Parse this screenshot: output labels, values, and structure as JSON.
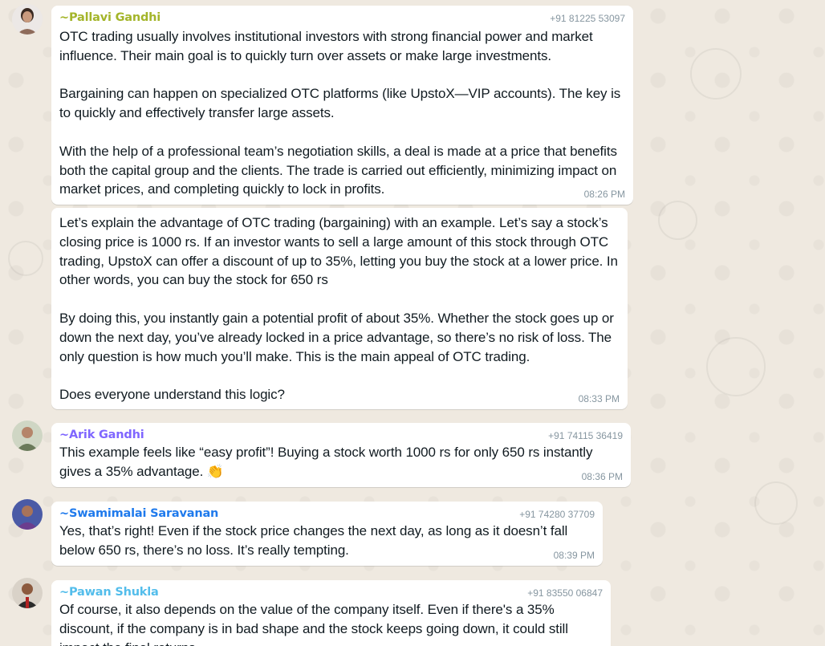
{
  "colors": {
    "background": "#efeae2",
    "bubble": "#ffffff",
    "text": "#111b21",
    "meta": "#8696a0"
  },
  "messages": [
    {
      "sender": "~Pallavi Gandhi",
      "sender_color": "#a4b52a",
      "phone": "+91 81225 53097",
      "paragraphs": [
        "OTC trading usually involves institutional investors with strong financial power and market influence. Their main goal is to quickly turn over assets or make large investments.",
        "Bargaining can happen on specialized OTC platforms (like UpstoX—VIP accounts). The key is to quickly and effectively transfer large assets.",
        "With the help of a professional team’s negotiation skills, a deal is made at a price that benefits both the capital group and the clients. The trade is carried out efficiently, minimizing impact on market prices, and completing quickly to lock in profits."
      ],
      "time": "08:26 PM"
    },
    {
      "paragraphs": [
        "Let’s explain the advantage of OTC trading (bargaining) with an example. Let’s say a stock’s closing price is 1000 rs. If an investor wants to sell a large amount of this stock through OTC trading, UpstoX can offer a discount of up to 35%, letting you buy the stock at a lower price. In other words, you can buy the stock for 650 rs",
        "By doing this, you instantly gain a potential profit of about 35%. Whether the stock goes up or down the next day, you’ve already locked in a price advantage, so there’s no risk of loss. The only question is how much you’ll make. This is the main appeal of OTC trading.",
        "Does everyone understand this logic?"
      ],
      "time": "08:33 PM"
    },
    {
      "sender": "~Arik Gandhi",
      "sender_color": "#7f66ff",
      "phone": "+91 74115 36419",
      "paragraphs": [
        "This example feels like “easy profit”! Buying a stock worth 1000 rs for only 650 rs instantly gives a 35% advantage. 👏"
      ],
      "time": "08:36 PM"
    },
    {
      "sender": "~Swamimalai  Saravanan",
      "sender_color": "#1f7aec",
      "phone": "+91 74280 37709",
      "paragraphs": [
        "Yes, that’s right! Even if the stock price changes the next day, as long as it doesn’t fall below 650 rs, there’s no loss. It’s really tempting."
      ],
      "time": "08:39 PM"
    },
    {
      "sender": "~Pawan Shukla",
      "sender_color": "#53bdeb",
      "phone": "+91 83550 06847",
      "paragraphs": [
        "Of course, it also depends on the value of the company itself. Even if there's a 35% discount, if the company is in bad shape and the stock keeps going down, it could still impact the final returns."
      ],
      "time": ""
    }
  ]
}
